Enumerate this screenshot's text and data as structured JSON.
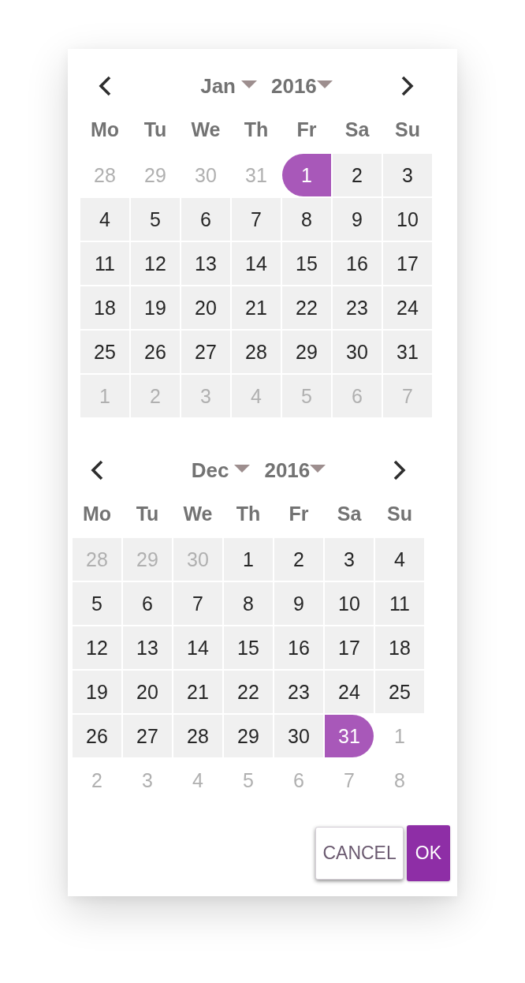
{
  "calendars": [
    {
      "month": "Jan",
      "year": "2016",
      "weekdays": [
        "Mo",
        "Tu",
        "We",
        "Th",
        "Fr",
        "Sa",
        "Su"
      ],
      "weeks": [
        [
          {
            "label": "28",
            "muted": true,
            "selected": false,
            "in_range": false
          },
          {
            "label": "29",
            "muted": true,
            "selected": false,
            "in_range": false
          },
          {
            "label": "30",
            "muted": true,
            "selected": false,
            "in_range": false
          },
          {
            "label": "31",
            "muted": true,
            "selected": false,
            "in_range": false
          },
          {
            "label": "1",
            "muted": false,
            "selected": true,
            "in_range": true
          },
          {
            "label": "2",
            "muted": false,
            "selected": false,
            "in_range": true
          },
          {
            "label": "3",
            "muted": false,
            "selected": false,
            "in_range": true
          }
        ],
        [
          {
            "label": "4",
            "muted": false,
            "selected": false,
            "in_range": true
          },
          {
            "label": "5",
            "muted": false,
            "selected": false,
            "in_range": true
          },
          {
            "label": "6",
            "muted": false,
            "selected": false,
            "in_range": true
          },
          {
            "label": "7",
            "muted": false,
            "selected": false,
            "in_range": true
          },
          {
            "label": "8",
            "muted": false,
            "selected": false,
            "in_range": true
          },
          {
            "label": "9",
            "muted": false,
            "selected": false,
            "in_range": true
          },
          {
            "label": "10",
            "muted": false,
            "selected": false,
            "in_range": true
          }
        ],
        [
          {
            "label": "11",
            "muted": false,
            "selected": false,
            "in_range": true
          },
          {
            "label": "12",
            "muted": false,
            "selected": false,
            "in_range": true
          },
          {
            "label": "13",
            "muted": false,
            "selected": false,
            "in_range": true
          },
          {
            "label": "14",
            "muted": false,
            "selected": false,
            "in_range": true
          },
          {
            "label": "15",
            "muted": false,
            "selected": false,
            "in_range": true
          },
          {
            "label": "16",
            "muted": false,
            "selected": false,
            "in_range": true
          },
          {
            "label": "17",
            "muted": false,
            "selected": false,
            "in_range": true
          }
        ],
        [
          {
            "label": "18",
            "muted": false,
            "selected": false,
            "in_range": true
          },
          {
            "label": "19",
            "muted": false,
            "selected": false,
            "in_range": true
          },
          {
            "label": "20",
            "muted": false,
            "selected": false,
            "in_range": true
          },
          {
            "label": "21",
            "muted": false,
            "selected": false,
            "in_range": true
          },
          {
            "label": "22",
            "muted": false,
            "selected": false,
            "in_range": true
          },
          {
            "label": "23",
            "muted": false,
            "selected": false,
            "in_range": true
          },
          {
            "label": "24",
            "muted": false,
            "selected": false,
            "in_range": true
          }
        ],
        [
          {
            "label": "25",
            "muted": false,
            "selected": false,
            "in_range": true
          },
          {
            "label": "26",
            "muted": false,
            "selected": false,
            "in_range": true
          },
          {
            "label": "27",
            "muted": false,
            "selected": false,
            "in_range": true
          },
          {
            "label": "28",
            "muted": false,
            "selected": false,
            "in_range": true
          },
          {
            "label": "29",
            "muted": false,
            "selected": false,
            "in_range": true
          },
          {
            "label": "30",
            "muted": false,
            "selected": false,
            "in_range": true
          },
          {
            "label": "31",
            "muted": false,
            "selected": false,
            "in_range": true
          }
        ],
        [
          {
            "label": "1",
            "muted": true,
            "selected": false,
            "in_range": true
          },
          {
            "label": "2",
            "muted": true,
            "selected": false,
            "in_range": true
          },
          {
            "label": "3",
            "muted": true,
            "selected": false,
            "in_range": true
          },
          {
            "label": "4",
            "muted": true,
            "selected": false,
            "in_range": true
          },
          {
            "label": "5",
            "muted": true,
            "selected": false,
            "in_range": true
          },
          {
            "label": "6",
            "muted": true,
            "selected": false,
            "in_range": true
          },
          {
            "label": "7",
            "muted": true,
            "selected": false,
            "in_range": true
          }
        ]
      ]
    },
    {
      "month": "Dec",
      "year": "2016",
      "weekdays": [
        "Mo",
        "Tu",
        "We",
        "Th",
        "Fr",
        "Sa",
        "Su"
      ],
      "weeks": [
        [
          {
            "label": "28",
            "muted": true,
            "selected": false,
            "in_range": true
          },
          {
            "label": "29",
            "muted": true,
            "selected": false,
            "in_range": true
          },
          {
            "label": "30",
            "muted": true,
            "selected": false,
            "in_range": true
          },
          {
            "label": "1",
            "muted": false,
            "selected": false,
            "in_range": true
          },
          {
            "label": "2",
            "muted": false,
            "selected": false,
            "in_range": true
          },
          {
            "label": "3",
            "muted": false,
            "selected": false,
            "in_range": true
          },
          {
            "label": "4",
            "muted": false,
            "selected": false,
            "in_range": true
          }
        ],
        [
          {
            "label": "5",
            "muted": false,
            "selected": false,
            "in_range": true
          },
          {
            "label": "6",
            "muted": false,
            "selected": false,
            "in_range": true
          },
          {
            "label": "7",
            "muted": false,
            "selected": false,
            "in_range": true
          },
          {
            "label": "8",
            "muted": false,
            "selected": false,
            "in_range": true
          },
          {
            "label": "9",
            "muted": false,
            "selected": false,
            "in_range": true
          },
          {
            "label": "10",
            "muted": false,
            "selected": false,
            "in_range": true
          },
          {
            "label": "11",
            "muted": false,
            "selected": false,
            "in_range": true
          }
        ],
        [
          {
            "label": "12",
            "muted": false,
            "selected": false,
            "in_range": true
          },
          {
            "label": "13",
            "muted": false,
            "selected": false,
            "in_range": true
          },
          {
            "label": "14",
            "muted": false,
            "selected": false,
            "in_range": true
          },
          {
            "label": "15",
            "muted": false,
            "selected": false,
            "in_range": true
          },
          {
            "label": "16",
            "muted": false,
            "selected": false,
            "in_range": true
          },
          {
            "label": "17",
            "muted": false,
            "selected": false,
            "in_range": true
          },
          {
            "label": "18",
            "muted": false,
            "selected": false,
            "in_range": true
          }
        ],
        [
          {
            "label": "19",
            "muted": false,
            "selected": false,
            "in_range": true
          },
          {
            "label": "20",
            "muted": false,
            "selected": false,
            "in_range": true
          },
          {
            "label": "21",
            "muted": false,
            "selected": false,
            "in_range": true
          },
          {
            "label": "22",
            "muted": false,
            "selected": false,
            "in_range": true
          },
          {
            "label": "23",
            "muted": false,
            "selected": false,
            "in_range": true
          },
          {
            "label": "24",
            "muted": false,
            "selected": false,
            "in_range": true
          },
          {
            "label": "25",
            "muted": false,
            "selected": false,
            "in_range": true
          }
        ],
        [
          {
            "label": "26",
            "muted": false,
            "selected": false,
            "in_range": true
          },
          {
            "label": "27",
            "muted": false,
            "selected": false,
            "in_range": true
          },
          {
            "label": "28",
            "muted": false,
            "selected": false,
            "in_range": true
          },
          {
            "label": "29",
            "muted": false,
            "selected": false,
            "in_range": true
          },
          {
            "label": "30",
            "muted": false,
            "selected": false,
            "in_range": true
          },
          {
            "label": "31",
            "muted": false,
            "selected": true,
            "in_range": true
          },
          {
            "label": "1",
            "muted": true,
            "selected": false,
            "in_range": false
          }
        ],
        [
          {
            "label": "2",
            "muted": true,
            "selected": false,
            "in_range": false
          },
          {
            "label": "3",
            "muted": true,
            "selected": false,
            "in_range": false
          },
          {
            "label": "4",
            "muted": true,
            "selected": false,
            "in_range": false
          },
          {
            "label": "5",
            "muted": true,
            "selected": false,
            "in_range": false
          },
          {
            "label": "6",
            "muted": true,
            "selected": false,
            "in_range": false
          },
          {
            "label": "7",
            "muted": true,
            "selected": false,
            "in_range": false
          },
          {
            "label": "8",
            "muted": true,
            "selected": false,
            "in_range": false
          }
        ]
      ]
    }
  ],
  "buttons": [
    {
      "label": "CANCEL",
      "kind": "secondary"
    },
    {
      "label": "OK",
      "kind": "primary"
    }
  ]
}
